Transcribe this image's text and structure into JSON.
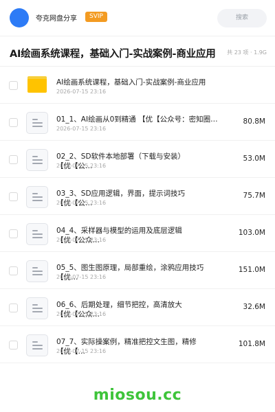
{
  "header": {
    "brand": "夸克网盘分享",
    "badge": "SVIP",
    "search_placeholder": "搜索"
  },
  "folder_title": "AI绘画系统课程，基础入门-实战案例-商业应用",
  "meta": "共 23 项 · 1.9G",
  "folder_item": {
    "name": "AI绘画系统课程，基础入门-实战案例-商业应用",
    "date": "2026-07-15 23:16"
  },
  "files": [
    {
      "name": "01_1、AI绘画从0到精通 【优【公众号：密知圈…",
      "name2": "",
      "date": "2026-07-15 23:16",
      "size": "80.8M"
    },
    {
      "name": "02_2、SD软件本地部署（下载与安装）",
      "name2": "【优【公…",
      "date": "2026-07-15 23:16",
      "size": "53.0M"
    },
    {
      "name": "03_3、SD应用逻辑，界面，提示词技巧",
      "name2": "【优【公…",
      "date": "2026-07-15 23:16",
      "size": "75.7M"
    },
    {
      "name": "04_4、采样器与模型的运用及底层逻辑",
      "name2": "【优【公众…",
      "date": "2026-07-15 23:16",
      "size": "103.0M"
    },
    {
      "name": "05_5、图生图原理，局部重绘，涂鸦应用技巧",
      "name2": "【优…",
      "date": "2026-07-15 23:16",
      "size": "151.0M"
    },
    {
      "name": "06_6、后期处理，细节把控，高清放大",
      "name2": "【优【公众…",
      "date": "2026-07-15 23:16",
      "size": "32.6M"
    },
    {
      "name": "07_7、实际操案例，精准把控文生图，精修",
      "name2": "【优【…",
      "date": "2026-07-15 23:16",
      "size": "101.8M"
    }
  ],
  "watermark": "miosou.cc",
  "colors": {
    "avatar": "#2d7bf6",
    "badge": "#f39b22",
    "folder": "#ffc300",
    "watermark": "#3ec43a"
  }
}
